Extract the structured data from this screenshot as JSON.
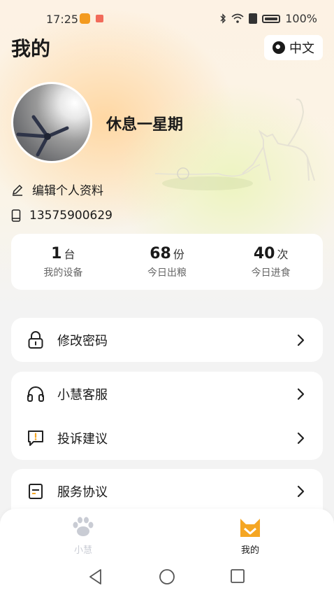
{
  "status_bar": {
    "time": "17:25",
    "battery": "100%"
  },
  "header": {
    "title": "我的",
    "language_button": "中文"
  },
  "profile": {
    "username": "休息一星期",
    "edit_profile": "编辑个人资料",
    "phone": "13575900629"
  },
  "stats": [
    {
      "value": "1",
      "unit": "台",
      "label": "我的设备"
    },
    {
      "value": "68",
      "unit": "份",
      "label": "今日出粮"
    },
    {
      "value": "40",
      "unit": "次",
      "label": "今日进食"
    }
  ],
  "menu": {
    "change_password": "修改密码",
    "customer_service": "小慧客服",
    "feedback": "投诉建议",
    "service_agreement": "服务协议"
  },
  "tabbar": {
    "home_label": "小慧",
    "mine_label": "我的"
  },
  "colors": {
    "accent": "#f5a623",
    "inactive": "#c9ccd4"
  },
  "icons": [
    "globe-icon",
    "edit-icon",
    "phone-icon",
    "lock-icon",
    "headset-icon",
    "feedback-icon",
    "document-icon",
    "paw-icon",
    "cat-face-icon",
    "back-icon",
    "home-icon",
    "recents-icon"
  ]
}
